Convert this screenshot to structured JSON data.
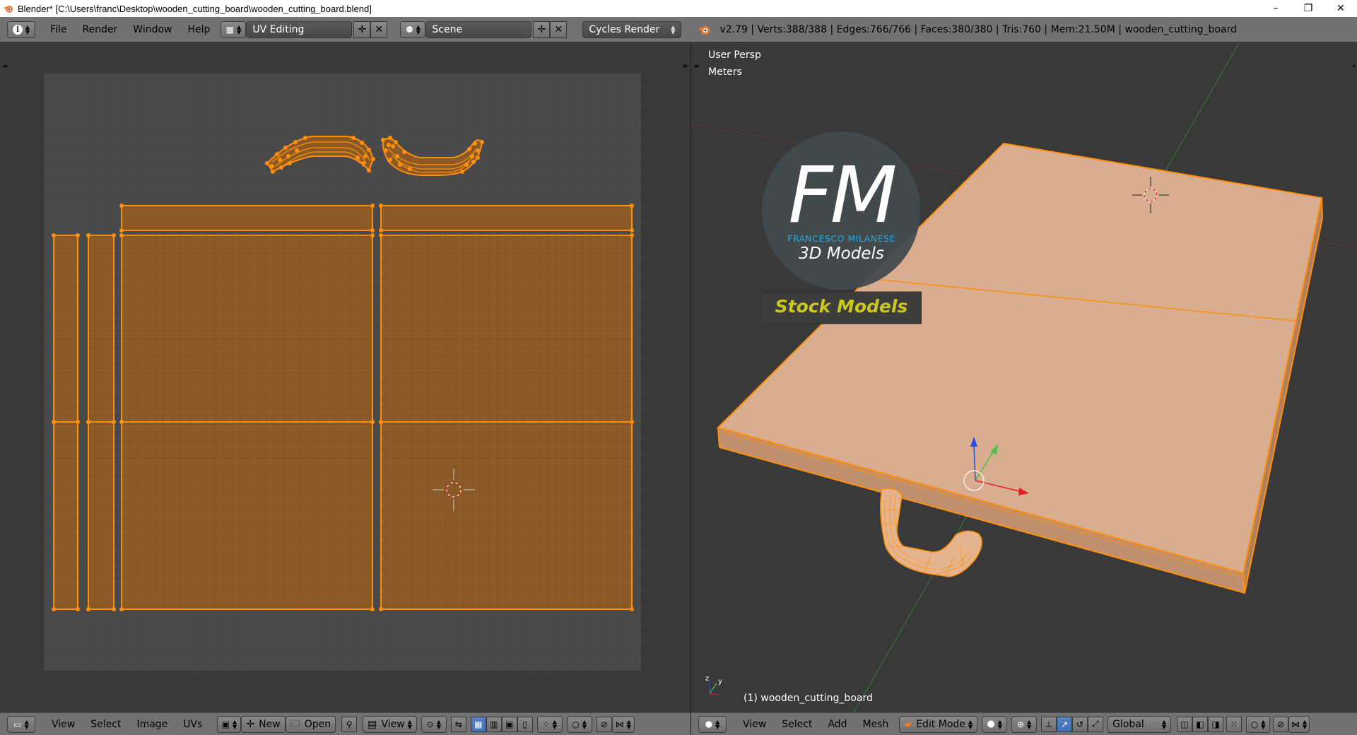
{
  "window": {
    "title": "Blender* [C:\\Users\\franc\\Desktop\\wooden_cutting_board\\wooden_cutting_board.blend]",
    "minimize": "–",
    "maximize": "❐",
    "close": "✕"
  },
  "info_header": {
    "menus": [
      "File",
      "Render",
      "Window",
      "Help"
    ],
    "screen_layout": "UV Editing",
    "scene": "Scene",
    "render_engine": "Cycles Render",
    "stats": "v2.79 | Verts:388/388 | Edges:766/766 | Faces:380/380 | Tris:760 | Mem:21.50M | wooden_cutting_board"
  },
  "viewport": {
    "view_name": "User Persp",
    "units": "Meters",
    "object_label": "(1) wooden_cutting_board",
    "logo": {
      "initials": "FM",
      "brand": "FRANCESCO MILANESE",
      "tagline": "3D Models",
      "banner": "Stock Models"
    }
  },
  "uv_header": {
    "menus": [
      "View",
      "Select",
      "Image",
      "UVs"
    ],
    "new_label": "New",
    "open_label": "Open",
    "view_label": "View"
  },
  "view3d_header": {
    "menus": [
      "View",
      "Select",
      "Add",
      "Mesh"
    ],
    "mode": "Edit Mode",
    "orientation": "Global"
  },
  "colors": {
    "header_bg": "#727272",
    "area_bg": "#393939",
    "uv_grid_bg": "#4a4a4a",
    "uv_face": "#8c5a26",
    "selection_orange": "#ff8f0d",
    "board_top": "#d9ad90",
    "board_side": "#c08f6e",
    "logo_blue": "#22a9e0",
    "logo_banner_text": "#c9c81e"
  }
}
